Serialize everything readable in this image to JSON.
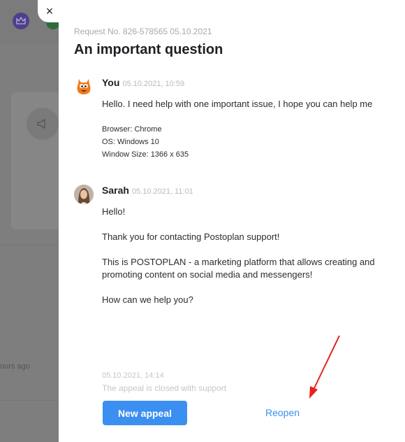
{
  "background": {
    "hours_text": "ours ago"
  },
  "close_symbol": "×",
  "request": {
    "number_line": "Request No. 826-578565 05.10.2021",
    "title": "An important question"
  },
  "messages": [
    {
      "author": "You",
      "time": "05.10.2021, 10:59",
      "text": "Hello. I need help with one important issue, I hope you can help me",
      "meta": {
        "browser": "Browser: Chrome",
        "os": "OS: Windows 10",
        "window": "Window Size: 1366 x 635"
      }
    },
    {
      "author": "Sarah",
      "time": "05.10.2021, 11:01",
      "lines": [
        "Hello!",
        "Thank you for contacting Postoplan support!",
        "This is POSTOPLAN - a marketing platform that allows creating and",
        "promoting content on social media and messengers!",
        "How can we help you?"
      ]
    }
  ],
  "status": {
    "date": "05.10.2021, 14:14",
    "note": "The appeal is closed with support"
  },
  "actions": {
    "new_appeal": "New appeal",
    "reopen": "Reopen"
  },
  "colors": {
    "accent": "#3b8ff0",
    "annotation_arrow": "#e8221b"
  }
}
